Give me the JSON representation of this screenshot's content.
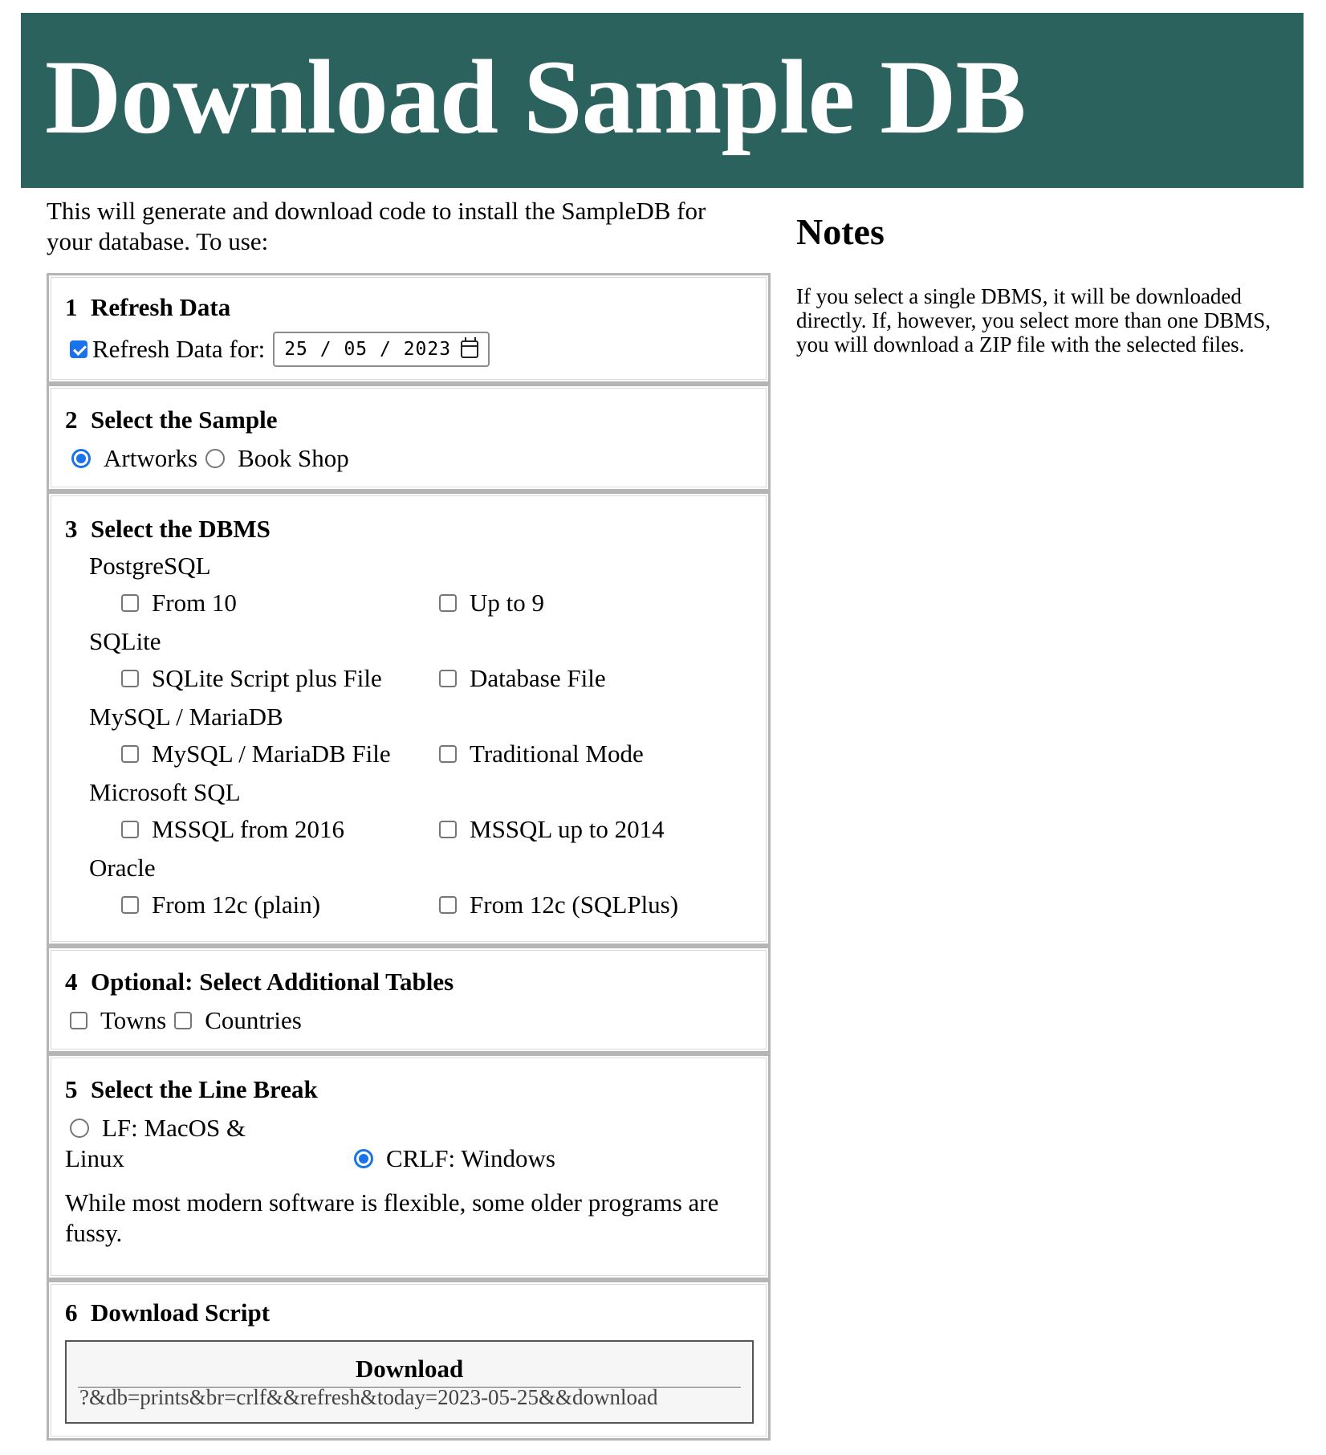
{
  "header": {
    "title": "Download Sample DB"
  },
  "intro": "This will generate and download code to install the SampleDB for your database. To use:",
  "steps": {
    "refresh": {
      "number": "1",
      "title": "Refresh Data",
      "checkbox_label": "Refresh Data for:",
      "checked": true,
      "date": {
        "day": "25",
        "month": "05",
        "year": "2023"
      }
    },
    "sample": {
      "number": "2",
      "title": "Select the Sample",
      "options": [
        {
          "label": "Artworks",
          "checked": true
        },
        {
          "label": "Book Shop",
          "checked": false
        }
      ]
    },
    "dbms": {
      "number": "3",
      "title": "Select the DBMS",
      "groups": [
        {
          "name": "PostgreSQL",
          "options": [
            "From 10",
            "Up to 9"
          ]
        },
        {
          "name": "SQLite",
          "options": [
            "SQLite Script plus File",
            "Database File"
          ]
        },
        {
          "name": "MySQL / MariaDB",
          "options": [
            "MySQL / MariaDB File",
            "Traditional Mode"
          ]
        },
        {
          "name": "Microsoft SQL",
          "options": [
            "MSSQL from 2016",
            "MSSQL up to 2014"
          ]
        },
        {
          "name": "Oracle",
          "options": [
            "From 12c (plain)",
            "From 12c (SQLPlus)"
          ]
        }
      ]
    },
    "tables": {
      "number": "4",
      "title": "Optional: Select Additional Tables",
      "options": [
        {
          "label": "Towns",
          "checked": false
        },
        {
          "label": "Countries",
          "checked": false
        }
      ]
    },
    "linebreak": {
      "number": "5",
      "title": "Select the Line Break",
      "lf_label_line1": "LF: MacOS &",
      "lf_label_line2": "Linux",
      "crlf_label": "CRLF: Windows",
      "selected": "CRLF",
      "note": "While most modern software is flexible, some older programs are fussy."
    },
    "download": {
      "number": "6",
      "title": "Download Script",
      "button_label": "Download",
      "url": "?&db=prints&br=crlf&&refresh&today=2023-05-25&&download"
    }
  },
  "notes": {
    "title": "Notes",
    "text": "If you select a single DBMS, it will be downloaded directly. If, however, you select more than one DBMS, you will download a ZIP file with the selected files."
  },
  "colors": {
    "banner": "#2c625d",
    "accent": "#1a73e8"
  }
}
